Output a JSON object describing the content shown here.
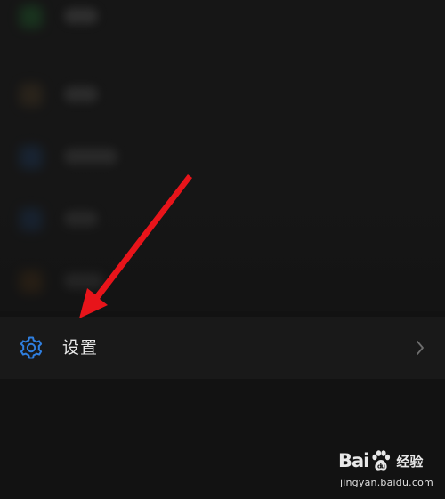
{
  "settings": {
    "label": "设置",
    "icon": "gear-icon",
    "chevron_icon": "chevron-right-icon",
    "accent_color": "#2f7fe0"
  },
  "blurred_items": [
    {
      "icon_color": "#1f5a2a"
    },
    {
      "icon_color": "#4a3a24"
    },
    {
      "icon_color": "#1d3f6b"
    },
    {
      "icon_color": "#1d3f6b"
    },
    {
      "icon_color": "#5a3a18"
    }
  ],
  "annotation": {
    "icon": "red-arrow-icon",
    "color": "#e8141a"
  },
  "watermark": {
    "brand_left": "Bai",
    "brand_right": "du",
    "product": "经验",
    "url": "jingyan.baidu.com"
  }
}
